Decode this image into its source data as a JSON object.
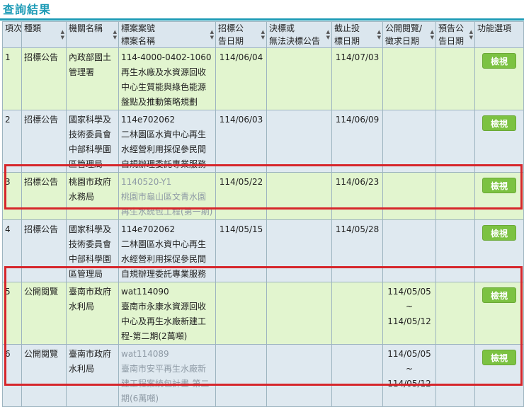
{
  "page": {
    "title": "查詢結果"
  },
  "headers": [
    {
      "line1": "項次",
      "line2": ""
    },
    {
      "line1": "種類",
      "line2": ""
    },
    {
      "line1": "機關名稱",
      "line2": ""
    },
    {
      "line1": "標案案號",
      "line2": "標案名稱"
    },
    {
      "line1": "招標公",
      "line2": "告日期"
    },
    {
      "line1": "決標或",
      "line2": "無法決標公告"
    },
    {
      "line1": "截止投",
      "line2": "標日期"
    },
    {
      "line1": "公開閱覽/",
      "line2": "徵求日期"
    },
    {
      "line1": "預告公",
      "line2": "告日期"
    },
    {
      "line1": "功能選項",
      "line2": ""
    }
  ],
  "view_label": "檢視",
  "rows": [
    {
      "no": "1",
      "type": "招標公告",
      "agency": "內政部國土管理署",
      "case_no": "114-4000-0402-1060",
      "case_name": "再生水廠及水資源回收中心生質能與綠色能源盤點及推動策略規劃",
      "muted": false,
      "pub_date": "114/06/04",
      "award": "",
      "deadline": "114/07/03",
      "review_start": "",
      "review_tilde": "",
      "review_end": "",
      "preview": ""
    },
    {
      "no": "2",
      "type": "招標公告",
      "agency": "國家科學及技術委員會中部科學園區管理局",
      "case_no": "114e702062",
      "case_name": "二林園區水資中心再生水經營利用採促參民間自規辦理委託專業服務",
      "muted": false,
      "pub_date": "114/06/03",
      "award": "",
      "deadline": "114/06/09",
      "review_start": "",
      "review_tilde": "",
      "review_end": "",
      "preview": ""
    },
    {
      "no": "3",
      "type": "招標公告",
      "agency": "桃園市政府水務局",
      "case_no": "1140520-Y1",
      "case_name": "桃園市龜山區文青水園再生水統包工程(第一期)",
      "muted": true,
      "pub_date": "114/05/22",
      "award": "",
      "deadline": "114/06/23",
      "review_start": "",
      "review_tilde": "",
      "review_end": "",
      "preview": ""
    },
    {
      "no": "4",
      "type": "招標公告",
      "agency": "國家科學及技術委員會中部科學園區管理局",
      "case_no": "114e702062",
      "case_name": "二林園區水資中心再生水經營利用採促參民間自規辦理委託專業服務",
      "muted": false,
      "pub_date": "114/05/15",
      "award": "",
      "deadline": "114/05/28",
      "review_start": "",
      "review_tilde": "",
      "review_end": "",
      "preview": ""
    },
    {
      "no": "5",
      "type": "公開閱覽",
      "agency": "臺南市政府水利局",
      "case_no": "wat114090",
      "case_name": "臺南市永康水資源回收中心及再生水廠新建工程-第二期(2萬噸)",
      "muted": false,
      "pub_date": "",
      "award": "",
      "deadline": "",
      "review_start": "114/05/05",
      "review_tilde": "~",
      "review_end": "114/05/12",
      "preview": ""
    },
    {
      "no": "6",
      "type": "公開閱覽",
      "agency": "臺南市政府水利局",
      "case_no": "wat114089",
      "case_name": "臺南市安平再生水廠新建工程案統包計畫-第二期(6萬噸)",
      "muted": true,
      "pub_date": "",
      "award": "",
      "deadline": "",
      "review_start": "114/05/05",
      "review_tilde": "~",
      "review_end": "114/05/12",
      "preview": ""
    }
  ],
  "colors": {
    "accent": "#1d9bb6",
    "row_green": "#e2f5cf",
    "row_blue": "#dfe9f0",
    "button": "#7cc242",
    "highlight": "#d6262b"
  }
}
